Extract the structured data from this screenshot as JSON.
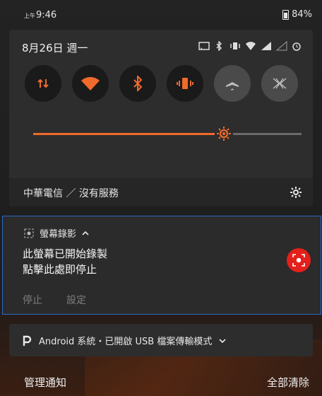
{
  "status_bar": {
    "time_prefix": "上午",
    "time": "9:46",
    "battery": "84%"
  },
  "quick_settings": {
    "date": "8月26日 週一",
    "tiles": [
      {
        "name": "data",
        "active": true
      },
      {
        "name": "wifi",
        "active": true
      },
      {
        "name": "bluetooth",
        "active": true
      },
      {
        "name": "vibrate",
        "active": true
      },
      {
        "name": "airplane",
        "active": false
      },
      {
        "name": "screen-mode",
        "active": false
      }
    ],
    "brightness_level": 0.71,
    "carrier": "中華電信 ／ 沒有服務",
    "accent_color": "#f06a2b"
  },
  "notification": {
    "app_name": "螢幕錄影",
    "title_line1": "此螢幕已開始錄製",
    "title_line2": "點擊此處即停止",
    "action_stop": "停止",
    "action_settings": "設定",
    "record_color": "#e3201b"
  },
  "notification2": {
    "text": "Android 系統・已開啟 USB 檔案傳輸模式"
  },
  "footer": {
    "manage": "管理通知",
    "clear_all": "全部清除"
  }
}
